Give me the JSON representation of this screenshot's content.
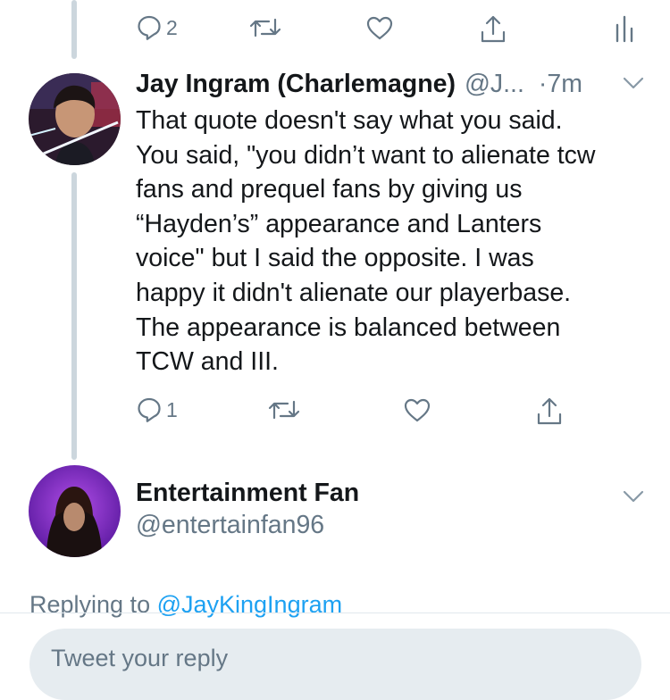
{
  "top_actions": {
    "reply_count": "2",
    "icons": [
      "reply-icon",
      "retweet-icon",
      "like-icon",
      "share-icon",
      "analytics-icon"
    ]
  },
  "tweet": {
    "name": "Jay Ingram (Charlemagne)",
    "handle": "@J...",
    "time": "·7m",
    "text": "That quote doesn't say what you said.\nYou said, \"you didn’t want to alienate tcw\nfans and prequel fans by giving us\n“Hayden’s” appearance and Lanters\nvoice\" but I said the opposite. I was\nhappy it didn't alienate our playerbase.\nThe appearance is balanced between\nTCW and III.",
    "reply_count": "1"
  },
  "composer": {
    "name": "Entertainment Fan",
    "handle": "@entertainfan96",
    "replying_prefix": "Replying to ",
    "replying_to": "@JayKingIngram",
    "placeholder": "Tweet your reply"
  },
  "colors": {
    "accent": "#1da1f2",
    "secondary_text": "#657786",
    "thread_line": "#ccd6dd",
    "input_bg": "#e6ecf0"
  }
}
